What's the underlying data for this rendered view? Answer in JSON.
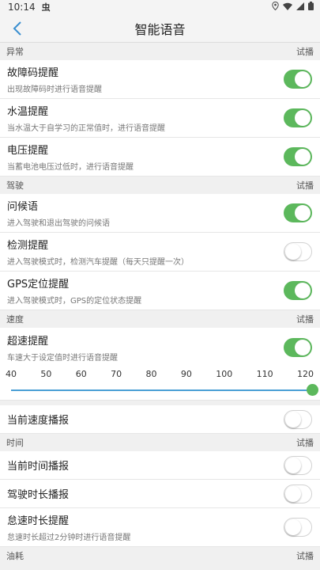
{
  "status_bar": {
    "time": "10:14",
    "bug_glyph": "虫"
  },
  "header": {
    "title": "智能语音"
  },
  "colors": {
    "toggle_on": "#5cb85c",
    "slider_track": "#4a9fd5"
  },
  "sections": {
    "abnormal": {
      "label": "异常",
      "try": "试播",
      "items": [
        {
          "title": "故障码提醒",
          "desc": "出现故障码时进行语音提醒",
          "on": true
        },
        {
          "title": "水温提醒",
          "desc": "当水温大于自学习的正常值时，进行语音提醒",
          "on": true
        },
        {
          "title": "电压提醒",
          "desc": "当蓄电池电压过低时，进行语音提醒",
          "on": true
        }
      ]
    },
    "driving": {
      "label": "驾驶",
      "try": "试播",
      "items": [
        {
          "title": "问候语",
          "desc": "进入驾驶和退出驾驶的问候语",
          "on": true
        },
        {
          "title": "检测提醒",
          "desc": "进入驾驶模式时，检测汽车提醒（每天只提醒一次）",
          "on": false
        },
        {
          "title": "GPS定位提醒",
          "desc": "进入驾驶模式时，GPS的定位状态提醒",
          "on": true
        }
      ]
    },
    "speed": {
      "label": "速度",
      "try": "试播",
      "overspeed": {
        "title": "超速提醒",
        "desc": "车速大于设定值时进行语音提醒",
        "on": true
      },
      "ticks": [
        "40",
        "50",
        "60",
        "70",
        "80",
        "90",
        "100",
        "110",
        "120"
      ],
      "slider_value": 120,
      "current_speed": {
        "title": "当前速度播报",
        "on": false
      }
    },
    "time": {
      "label": "时间",
      "try": "试播",
      "current_time": {
        "title": "当前时间播报",
        "on": false
      },
      "drive_duration": {
        "title": "驾驶时长播报",
        "on": false
      },
      "idle": {
        "title": "怠速时长提醒",
        "desc": "怠速时长超过2分钟时进行语音提醒",
        "on": false
      }
    },
    "fuel": {
      "label": "油耗",
      "try": "试播"
    }
  }
}
